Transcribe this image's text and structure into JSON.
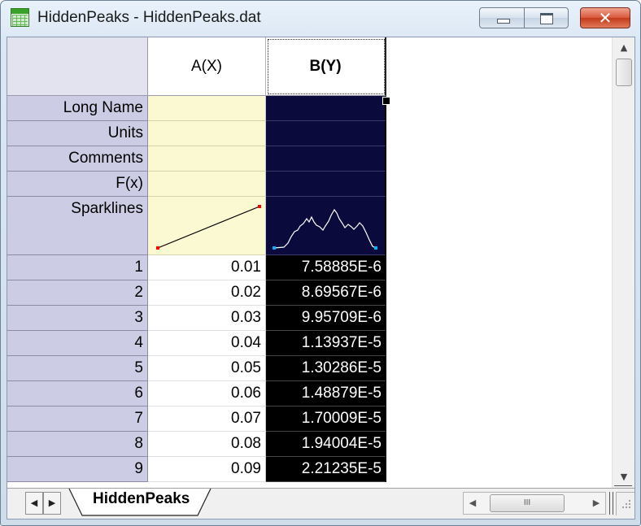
{
  "window": {
    "title": "HiddenPeaks - HiddenPeaks.dat",
    "close_symbol": "✕",
    "icon": "worksheet-icon"
  },
  "sheet": {
    "columns": [
      "A(X)",
      "B(Y)"
    ],
    "selected_column": "B(Y)",
    "label_rows": [
      "Long Name",
      "Units",
      "Comments",
      "F(x)",
      "Sparklines"
    ],
    "rows": [
      {
        "n": "1",
        "x": "0.01",
        "y": "7.58885E-6"
      },
      {
        "n": "2",
        "x": "0.02",
        "y": "8.69567E-6"
      },
      {
        "n": "3",
        "x": "0.03",
        "y": "9.95709E-6"
      },
      {
        "n": "4",
        "x": "0.04",
        "y": "1.13937E-5"
      },
      {
        "n": "5",
        "x": "0.05",
        "y": "1.30286E-5"
      },
      {
        "n": "6",
        "x": "0.06",
        "y": "1.48879E-5"
      },
      {
        "n": "7",
        "x": "0.07",
        "y": "1.70009E-5"
      },
      {
        "n": "8",
        "x": "0.08",
        "y": "1.94004E-5"
      },
      {
        "n": "9",
        "x": "0.09",
        "y": "2.21235E-5"
      }
    ],
    "tab_name": "HiddenPeaks",
    "hscroll_grip": "III"
  },
  "colors": {
    "selected_bg": "#0a0a3c",
    "label_row_bg": "#fbf9d2",
    "row_header_bg": "#cccce4",
    "sparkline_line": "#ffffff",
    "sparkline_endpoint": "#00b0ff",
    "sparkline_a_endpoint": "#ff0000"
  }
}
